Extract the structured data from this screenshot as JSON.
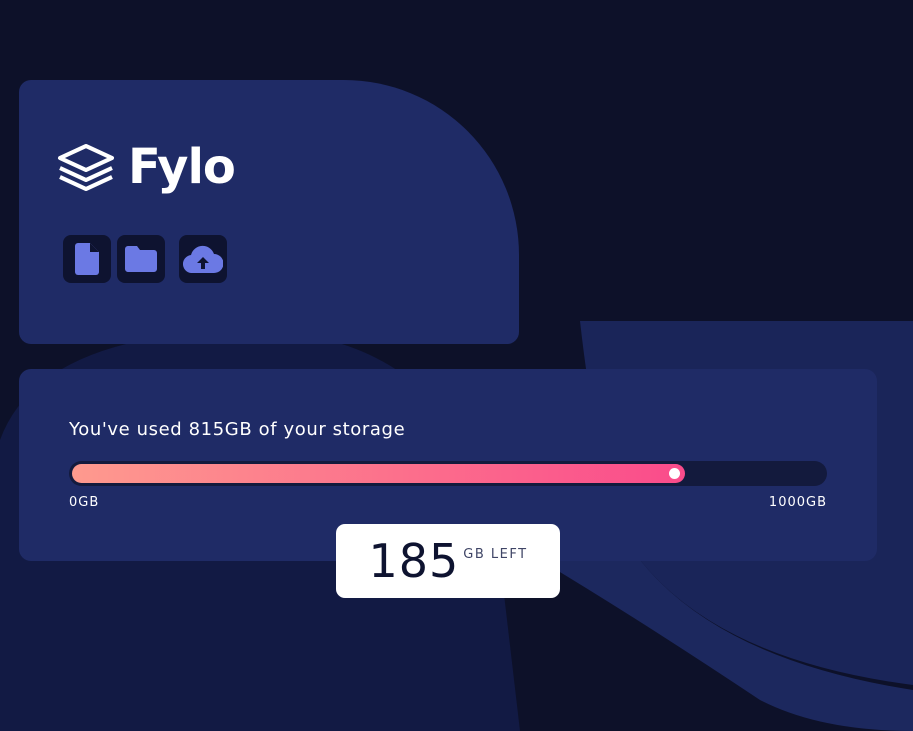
{
  "brand": {
    "name": "Fylo"
  },
  "toolbar": {
    "icons": [
      "document-icon",
      "folder-icon",
      "cloud-upload-icon"
    ]
  },
  "storage": {
    "usage_text": "You've used 815GB of your storage",
    "used_gb": 815,
    "total_gb": 1000,
    "min_label": "0GB",
    "max_label": "1000GB",
    "left_value": "185",
    "left_unit": "GB LEFT"
  },
  "colors": {
    "background": "#0d1129",
    "card": "#1f2b66",
    "icon_bg": "#0e1330",
    "icon_accent": "#6b79e4",
    "gradient_start": "#fe9a8e",
    "gradient_end": "#fa4b8b"
  }
}
